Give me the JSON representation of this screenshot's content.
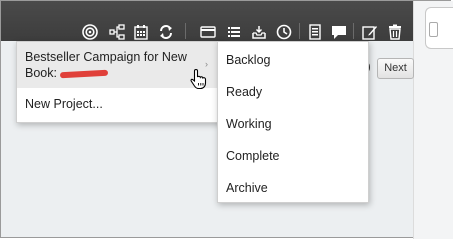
{
  "pager": {
    "paren": ")",
    "next_label": "Next"
  },
  "menu": {
    "items": [
      {
        "label": "Bestseller Campaign for New Book:",
        "redacted": true,
        "has_submenu": true
      },
      {
        "label": "New Project..."
      }
    ],
    "submenu_arrow": "›"
  },
  "submenu": {
    "items": [
      "Backlog",
      "Ready",
      "Working",
      "Complete",
      "Archive"
    ]
  },
  "toolbar": {
    "icons": [
      "target-icon",
      "hierarchy-icon",
      "calendar-icon",
      "refresh-icon",
      "card-icon",
      "list-icon",
      "inbox-tray-icon",
      "clock-icon",
      "document-list-icon",
      "comment-icon",
      "edit-icon",
      "trash-icon"
    ]
  },
  "colors": {
    "toolbar": "#3f3f3f",
    "menu_highlight": "#eaeaea",
    "redaction": "#e0403a"
  }
}
